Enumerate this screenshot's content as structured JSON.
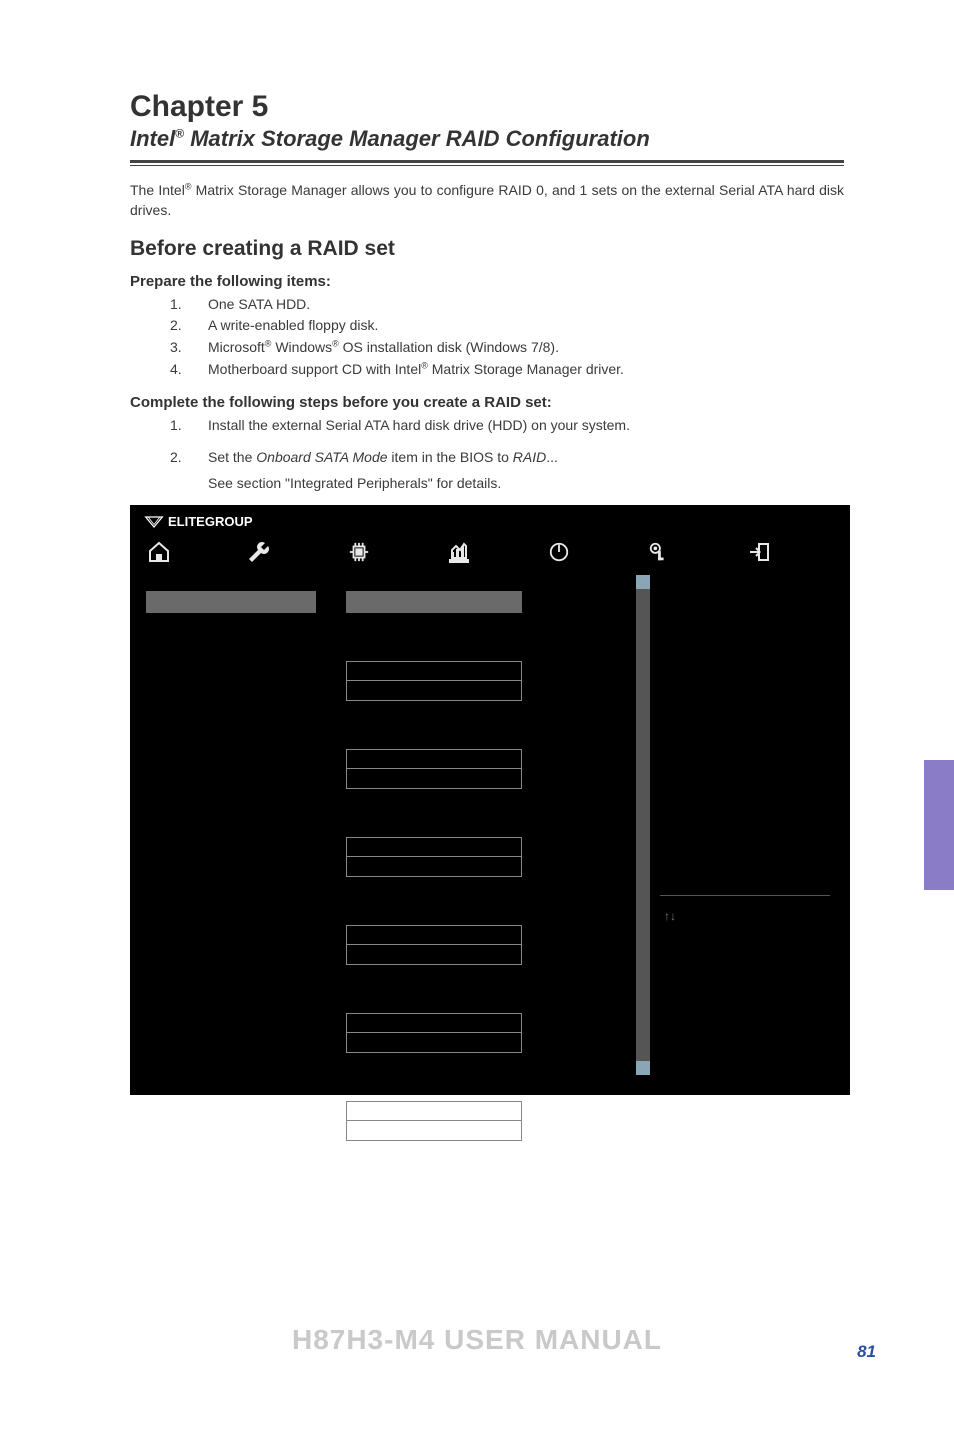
{
  "chapter": {
    "title": "Chapter 5"
  },
  "subtitle": {
    "prefix": "Intel",
    "reg": "®",
    "rest": " Matrix Storage Manager RAID Configuration"
  },
  "intro": {
    "p1a": "The Intel",
    "p1reg": "®",
    "p1b": " Matrix Storage Manager allows you to configure RAID 0, and 1 sets on the external Serial ATA hard disk drives."
  },
  "section1": {
    "heading": "Before creating a RAID set"
  },
  "prepare": {
    "heading": "Prepare the following items:",
    "items": [
      {
        "n": "1.",
        "t": "One SATA HDD."
      },
      {
        "n": "2.",
        "t": "A write-enabled floppy disk."
      },
      {
        "n": "3.",
        "t_pre": "Microsoft",
        "r1": "®",
        "t_mid": " Windows",
        "r2": "®",
        "t_post": " OS installation disk (Windows 7/8)."
      },
      {
        "n": "4.",
        "t_pre": "Motherboard support CD with Intel",
        "r1": "®",
        "t_post": " Matrix Storage Manager driver."
      }
    ]
  },
  "complete": {
    "heading": "Complete the following steps before you create a RAID set:",
    "items": [
      {
        "n": "1.",
        "t": "Install the external Serial ATA hard disk drive (HDD) on your system."
      },
      {
        "n": "2.",
        "t_pre": "Set the ",
        "i1": "Onboard SATA Mode",
        "t_mid": " item in the BIOS to ",
        "i2": "RAID",
        "t_post": "..."
      }
    ],
    "note": "See section \"Integrated Peripherals\" for details."
  },
  "bios": {
    "logo": "ELITEGROUP",
    "icons": [
      "home-icon",
      "wrench-icon",
      "chip-icon",
      "chart-icon",
      "power-icon",
      "key-icon",
      "exit-icon"
    ],
    "arrow_hint": "↑↓"
  },
  "footer": {
    "brand": "H87H3-M4 USER MANUAL"
  },
  "page_number": "81"
}
